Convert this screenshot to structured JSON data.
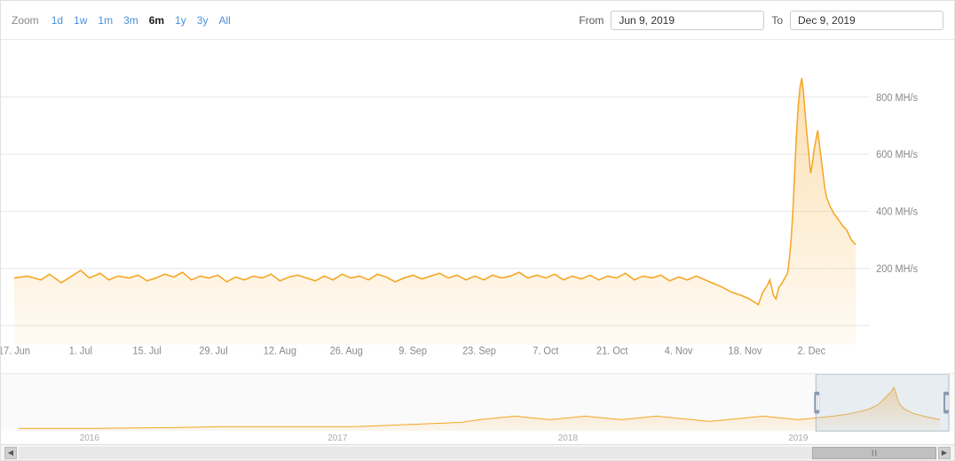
{
  "toolbar": {
    "zoom_label": "Zoom",
    "zoom_buttons": [
      "1d",
      "1w",
      "1m",
      "3m",
      "6m",
      "1y",
      "3y",
      "All"
    ],
    "active_zoom": "6m",
    "from_label": "From",
    "to_label": "To",
    "from_date": "Jun 9, 2019",
    "to_date": "Dec 9, 2019"
  },
  "chart": {
    "y_labels": [
      "800 MH/s",
      "600 MH/s",
      "400 MH/s",
      "200 MH/s"
    ],
    "x_labels": [
      "17. Jun",
      "1. Jul",
      "15. Jul",
      "29. Jul",
      "12. Aug",
      "26. Aug",
      "9. Sep",
      "23. Sep",
      "7. Oct",
      "21. Oct",
      "4. Nov",
      "18. Nov",
      "2. Dec"
    ]
  },
  "navigator": {
    "x_labels": [
      "2016",
      "2017",
      "2018",
      "2019"
    ]
  }
}
